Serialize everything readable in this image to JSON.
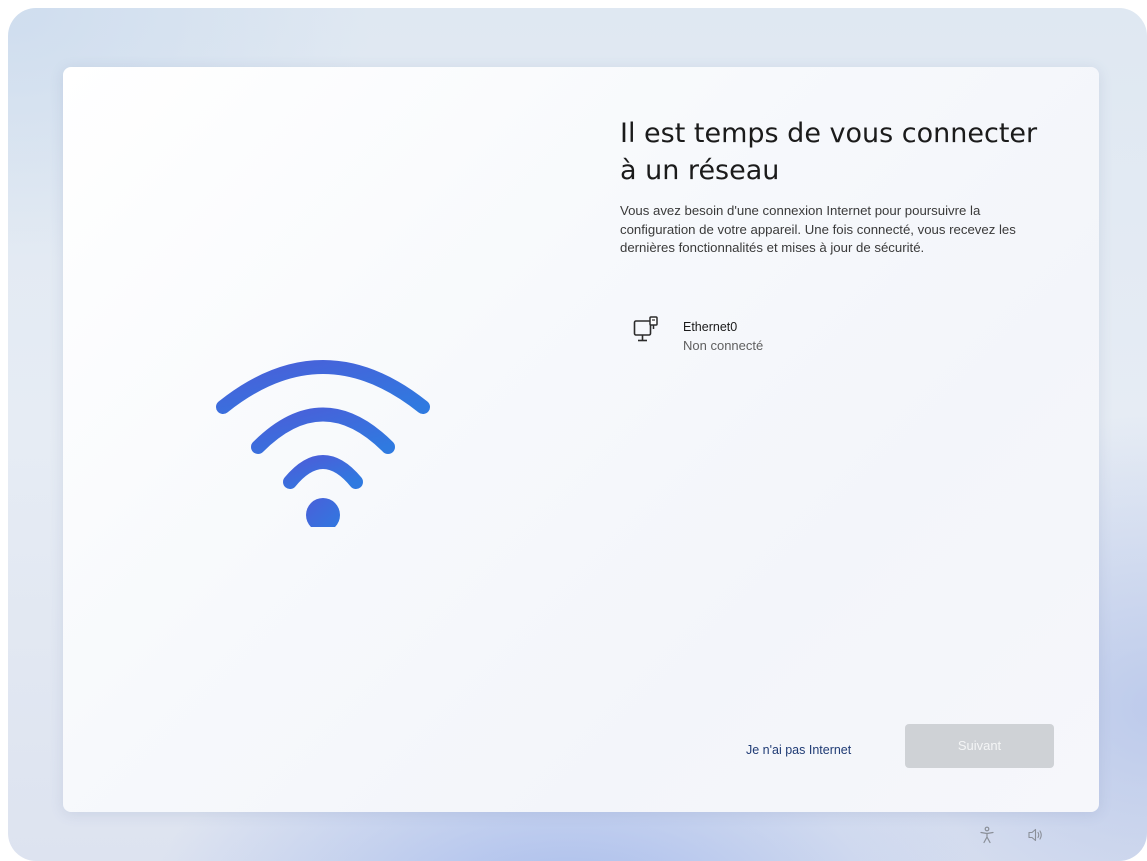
{
  "setup": {
    "title": "Il est temps de vous connecter à un réseau",
    "description": "Vous avez besoin d'une connexion Internet pour poursuivre la configuration de votre appareil. Une fois connecté, vous recevez les dernières fonctionnalités et mises à jour de sécurité.",
    "hero_icon": "wifi-icon"
  },
  "networks": [
    {
      "name": "Ethernet0",
      "status": "Non connecté",
      "icon": "ethernet-icon"
    }
  ],
  "actions": {
    "no_internet_label": "Je n'ai pas Internet",
    "next_label": "Suivant",
    "next_enabled": false
  },
  "tray": {
    "icons": [
      "accessibility-icon",
      "volume-icon"
    ]
  },
  "colors": {
    "accent_link": "#1f3b74",
    "wifi_gradient_start": "#4a5fd9",
    "wifi_gradient_end": "#2f7ae0",
    "button_disabled_bg": "#cfd2d6"
  }
}
